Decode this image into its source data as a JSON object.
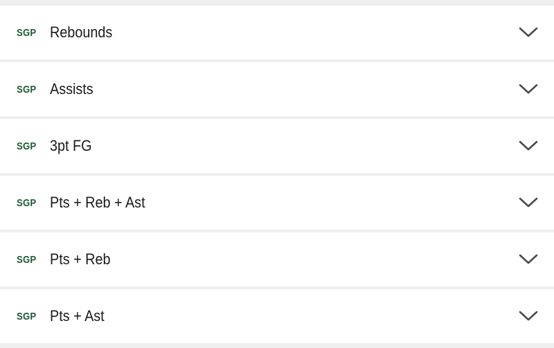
{
  "badge_text": "SGP",
  "colors": {
    "badge": "#1f5a32",
    "row_bg": "#ffffff",
    "separator": "#efefef",
    "chevron": "#4a4a4a"
  },
  "rows": [
    {
      "label": "Rebounds",
      "icon": "chevron-down-icon"
    },
    {
      "label": "Assists",
      "icon": "chevron-down-icon"
    },
    {
      "label": "3pt FG",
      "icon": "chevron-down-icon"
    },
    {
      "label": "Pts + Reb + Ast",
      "icon": "chevron-down-icon"
    },
    {
      "label": "Pts + Reb",
      "icon": "chevron-down-icon"
    },
    {
      "label": "Pts + Ast",
      "icon": "chevron-down-icon"
    }
  ]
}
